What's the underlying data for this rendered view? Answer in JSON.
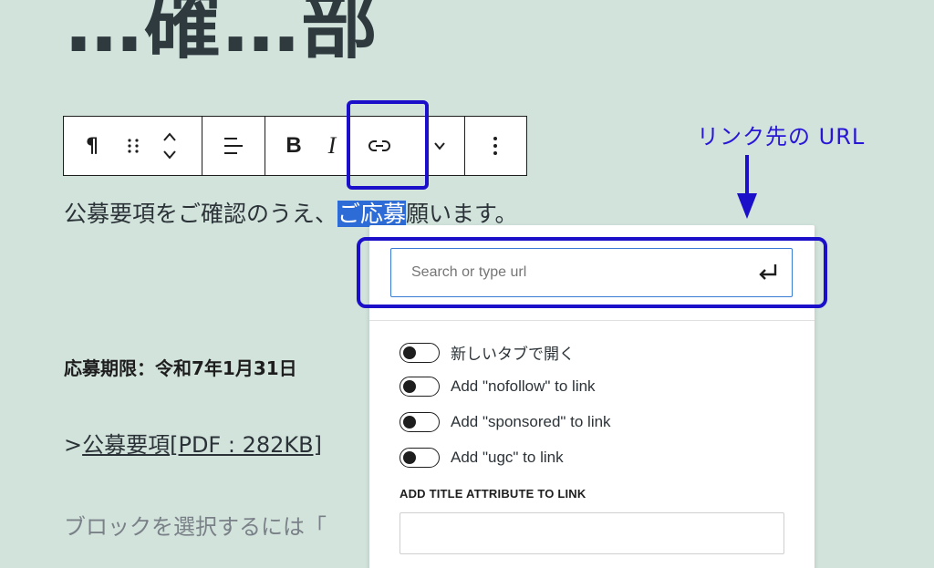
{
  "heading": "…確…部",
  "toolbar": {
    "paragraph": "¶",
    "drag": "⠿",
    "move": "⌃",
    "align": "☰",
    "bold": "B",
    "italic": "I",
    "more_rich": "⌄",
    "options": "⋮"
  },
  "annotation": {
    "label": "リンク先の URL"
  },
  "content": {
    "para_before": "公募要項をご確認のうえ、",
    "para_selected": "ご応募",
    "para_after": "願います。",
    "deadline": "応募期限：令和7年1月31日",
    "pdf_prefix": ">",
    "pdf_link_text": "公募要項",
    "pdf_link_suffix": "[PDF : 282KB]",
    "placeholder": "ブロックを選択するには「"
  },
  "link_popover": {
    "url_placeholder": "Search or type url",
    "url_value": "",
    "toggles": [
      {
        "label": "新しいタブで開く",
        "on": false
      },
      {
        "label": "Add \"nofollow\" to link",
        "on": false
      },
      {
        "label": "Add \"sponsored\" to link",
        "on": false
      },
      {
        "label": "Add \"ugc\" to link",
        "on": false
      }
    ],
    "title_attr_label": "ADD TITLE ATTRIBUTE TO LINK",
    "title_attr_value": ""
  },
  "colors": {
    "background": "#d2e3dc",
    "annotation": "#1b0fc9",
    "selection": "#2d6bd6"
  }
}
